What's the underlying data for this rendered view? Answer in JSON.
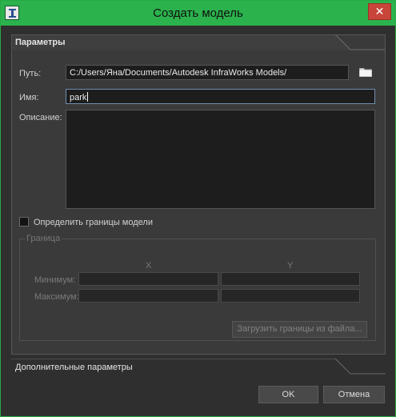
{
  "window": {
    "title": "Создать модель",
    "close_glyph": "✕",
    "app_icon": "autodesk-infraworks-icon"
  },
  "params": {
    "tab_label": "Параметры",
    "path_label": "Путь:",
    "path_value": "C:/Users/Яна/Documents/Autodesk InfraWorks Models/",
    "name_label": "Имя:",
    "name_value": "park",
    "desc_label": "Описание:",
    "desc_value": "",
    "define_bounds_label": "Определить границы модели",
    "define_bounds_checked": false
  },
  "bounds": {
    "group_label": "Граница",
    "col_x": "X",
    "col_y": "Y",
    "min_label": "Минимум:",
    "max_label": "Максимум:",
    "load_button": "Загрузить границы из файла..."
  },
  "advanced": {
    "label": "Дополнительные параметры"
  },
  "footer": {
    "ok": "OK",
    "cancel": "Отмена"
  },
  "colors": {
    "titlebar": "#2bb24c",
    "window_bg": "#2f2f2f",
    "panel_bg": "#3a3a3a",
    "close": "#c8453a"
  }
}
